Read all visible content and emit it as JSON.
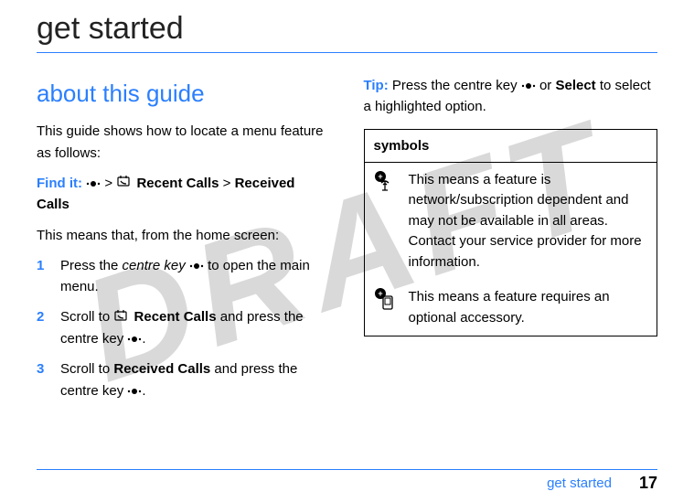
{
  "watermark": "DRAFT",
  "page_title": "get started",
  "left": {
    "heading": "about this guide",
    "intro": "This guide shows how to locate a menu feature as follows:",
    "find_label": "Find it:",
    "path_gt": ">",
    "path_recent": "Recent Calls",
    "path_received": "Received Calls",
    "means": "This means that, from the home screen:",
    "steps": [
      {
        "n": "1",
        "pre": "Press the ",
        "mid": "centre key",
        "post": " to open the main menu."
      },
      {
        "n": "2",
        "pre": "Scroll to ",
        "bold": "Recent Calls",
        "post1": " and press the centre key",
        "post2": "."
      },
      {
        "n": "3",
        "pre": "Scroll to ",
        "bold": "Received Calls",
        "post1": " and press the centre key ",
        "post2": "."
      }
    ]
  },
  "right": {
    "tip_label": "Tip:",
    "tip_pre": " Press the centre key ",
    "tip_or": " or ",
    "tip_select": "Select",
    "tip_post": " to select a highlighted option.",
    "symbols_header": "symbols",
    "rows": [
      {
        "text": "This means a feature is network/subscription dependent and may not be available in all areas. Contact your service provider for more information."
      },
      {
        "text": "This means a feature requires an optional accessory."
      }
    ]
  },
  "footer": {
    "section": "get started",
    "page": "17"
  }
}
